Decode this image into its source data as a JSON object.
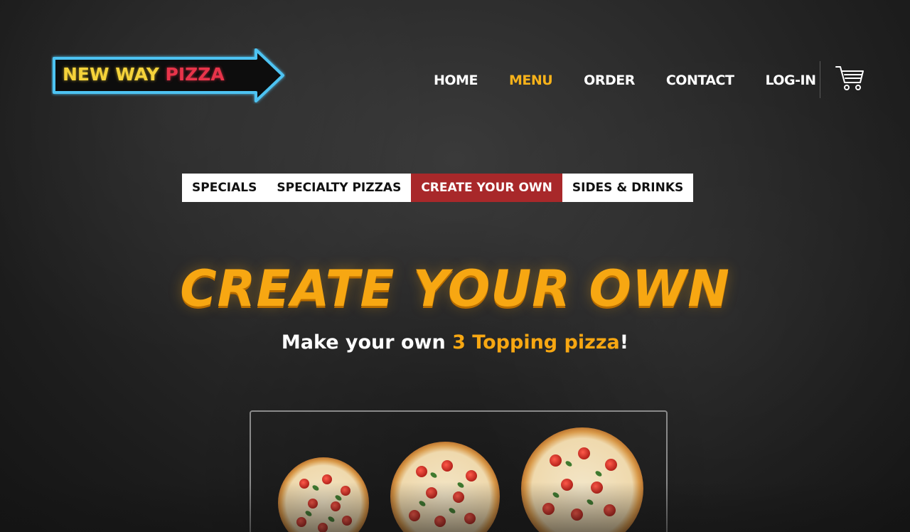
{
  "logo": {
    "word1": "NEW WAY",
    "word2": "PIZZA"
  },
  "nav": {
    "items": [
      {
        "label": "HOME",
        "active": false
      },
      {
        "label": "MENU",
        "active": true
      },
      {
        "label": "ORDER",
        "active": false
      },
      {
        "label": "CONTACT",
        "active": false
      },
      {
        "label": "LOG-IN",
        "active": false
      }
    ],
    "cart_icon": "cart-icon"
  },
  "subnav": {
    "items": [
      {
        "label": "SPECIALS",
        "active": false
      },
      {
        "label": "SPECIALTY PIZZAS",
        "active": false
      },
      {
        "label": "CREATE YOUR OWN",
        "active": true
      },
      {
        "label": "SIDES & DRINKS",
        "active": false
      }
    ]
  },
  "hero": {
    "title": "CREATE YOUR OWN",
    "subtitle_prefix": "Make your own ",
    "subtitle_highlight": "3 Topping pizza",
    "subtitle_suffix": "!"
  },
  "colors": {
    "accent": "#f7a712",
    "active_tab": "#a8282a",
    "logo_yellow": "#f5d33a",
    "logo_red": "#e8344a",
    "logo_outline": "#4ec3f2"
  }
}
